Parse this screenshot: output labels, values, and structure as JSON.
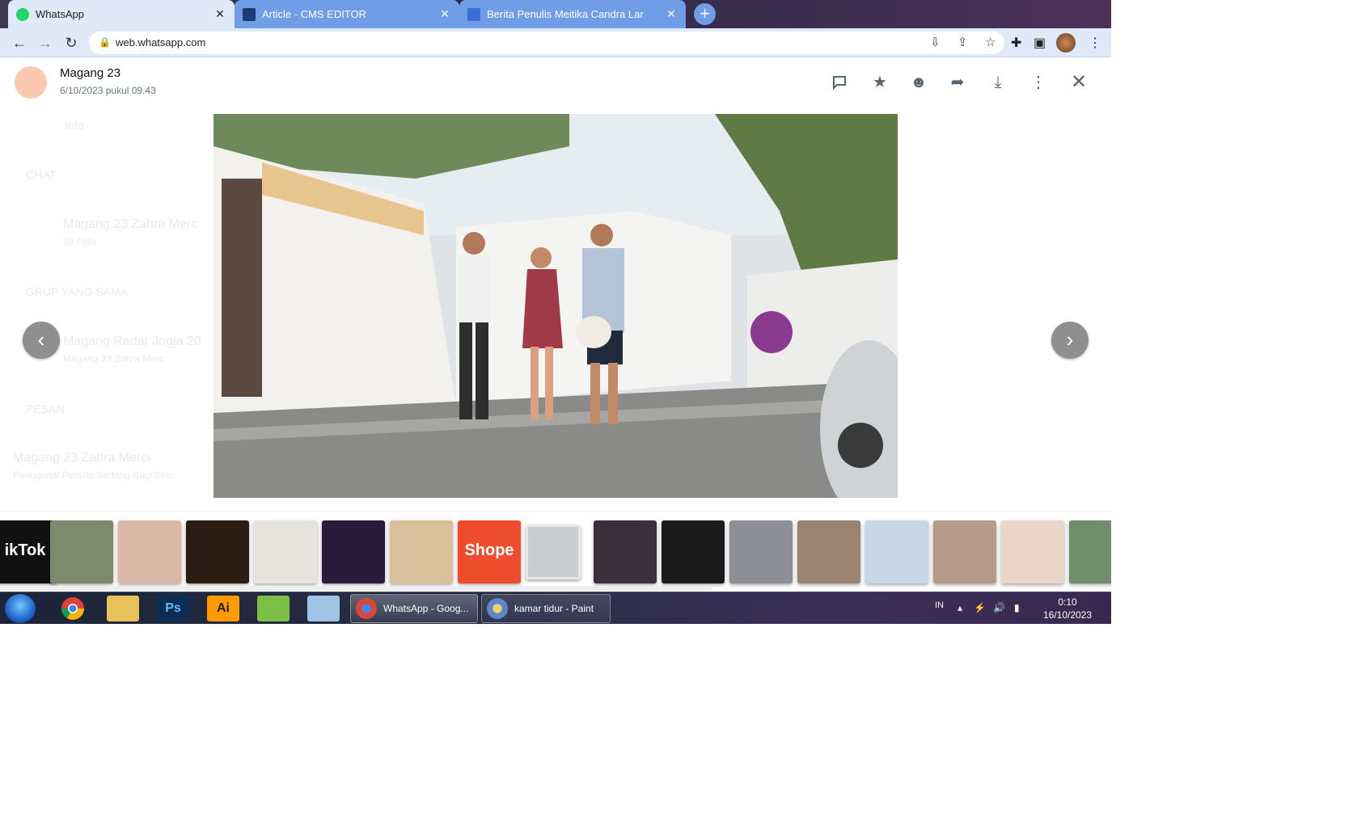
{
  "browser": {
    "tabs": [
      {
        "label": "WhatsApp",
        "favicon_color": "#25D366",
        "active": true
      },
      {
        "label": "Article - CMS EDITOR",
        "favicon_color": "#1f3b73",
        "active": false
      },
      {
        "label": "Berita Penulis Meitika Candra Lar",
        "favicon_color": "#3a6fd8",
        "active": false
      }
    ],
    "new_tab_label": "+",
    "url": "web.whatsapp.com"
  },
  "viewer": {
    "sender_name": "Magang 23",
    "sender_time": "6/10/2023 pukul 09.43",
    "actions": [
      "reply-icon",
      "star-icon",
      "emoji-icon",
      "forward-icon",
      "download-icon",
      "menu-icon",
      "close-icon"
    ],
    "background_text": [
      "Info",
      "CHAT",
      "Magang 23 Zahra Merc",
      "38 Foto",
      "GRUP YANG SAMA",
      "Magang Radar Jogja 20",
      "Magang 23 Zahra Merc",
      "PESAN",
      "Magang 23 Zahra Merci",
      "Penggunal Penulis Sedang Bagi Seb"
    ],
    "thumbnails": [
      {
        "label": "ikTok",
        "bg": "#111111",
        "fg": "#ffffff"
      },
      {
        "label": "",
        "bg": "#7d8a6e"
      },
      {
        "label": "",
        "bg": "#d9b8a6"
      },
      {
        "label": "",
        "bg": "#2a1c12"
      },
      {
        "label": "",
        "bg": "#e6e2dc"
      },
      {
        "label": "",
        "bg": "#2c1a3a"
      },
      {
        "label": "",
        "bg": "#d9bf9a"
      },
      {
        "label": "Shope",
        "bg": "#ee4d2d",
        "fg": "#ffffff"
      },
      {
        "label": "",
        "bg": "#c8cccf",
        "selected": true
      },
      {
        "label": "",
        "bg": "#3b2f3a"
      },
      {
        "label": "",
        "bg": "#1b1b1b"
      },
      {
        "label": "",
        "bg": "#8d8f94"
      },
      {
        "label": "",
        "bg": "#9a8472"
      },
      {
        "label": "",
        "bg": "#c8d6e6"
      },
      {
        "label": "",
        "bg": "#b89a8a"
      },
      {
        "label": "",
        "bg": "#e9d6c9"
      },
      {
        "label": "",
        "bg": "#6f8f6a"
      }
    ]
  },
  "taskbar": {
    "pinned": [
      {
        "name": "chrome-icon",
        "label": ""
      },
      {
        "name": "explorer-icon",
        "label": ""
      },
      {
        "name": "photoshop-icon",
        "label": "Ps"
      },
      {
        "name": "illustrator-icon",
        "label": "Ai"
      },
      {
        "name": "green-app-icon",
        "label": ""
      },
      {
        "name": "notes-app-icon",
        "label": ""
      }
    ],
    "tasks": [
      {
        "label": "WhatsApp - Goog..."
      },
      {
        "label": "kamar tidur - Paint"
      }
    ],
    "lang": "IN",
    "time": "0:10",
    "date": "16/10/2023"
  }
}
